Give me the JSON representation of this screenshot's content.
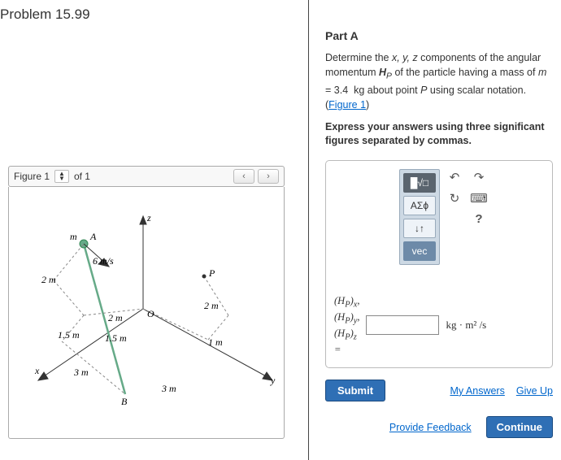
{
  "problem": {
    "title": "Problem 15.99"
  },
  "figure": {
    "label": "Figure 1",
    "selector_text": "of 1",
    "annotations": {
      "m": "m",
      "A": "A",
      "vel": "6 m/s",
      "two_m_left": "2 m",
      "one_five_lower": "1.5 m",
      "two_m_mid": "2 m",
      "one_five_ctr": "1.5 m",
      "three_m_left": "3 m",
      "B": "B",
      "three_m_right": "3 m",
      "one_m": "1 m",
      "two_m_right": "2 m",
      "O": "O",
      "P": "P",
      "x": "x",
      "y": "y",
      "z": "z"
    }
  },
  "partA": {
    "heading": "Part A",
    "prompt_1": "Determine the ",
    "prompt_vars": "x, y, z",
    "prompt_2": " components of the angular momentum ",
    "prompt_H": "H",
    "prompt_Hsub": "P",
    "prompt_3": " of the particle having a mass of ",
    "prompt_m": "m",
    "prompt_4": " = 3.4  kg about point ",
    "prompt_P": "P",
    "prompt_5": " using scalar notation. (",
    "fig_link": "Figure 1",
    "prompt_6": ")",
    "instruct": "Express your answers using three significant figures separated by commas.",
    "tools": {
      "sqrt": "█√□",
      "greek": "ΑΣϕ",
      "sub": "↓↑",
      "vec": "vec"
    },
    "side": {
      "undo": "↶",
      "redo": "↷",
      "reset": "↻",
      "kb": "⌨",
      "help": "?"
    },
    "lhs": {
      "l1": "(H",
      "s1": "P",
      "t1": ")",
      "c1": "x",
      "comma": ",",
      "l2": "(H",
      "s2": "P",
      "t2": ")",
      "c2": "y",
      "l3": "(H",
      "s3": "P",
      "t3": ")",
      "c3": "z",
      "eq": "="
    },
    "units": "kg · m² /s",
    "submit": "Submit",
    "myans": "My Answers",
    "giveup": "Give Up",
    "feedback": "Provide Feedback",
    "cont": "Continue"
  }
}
